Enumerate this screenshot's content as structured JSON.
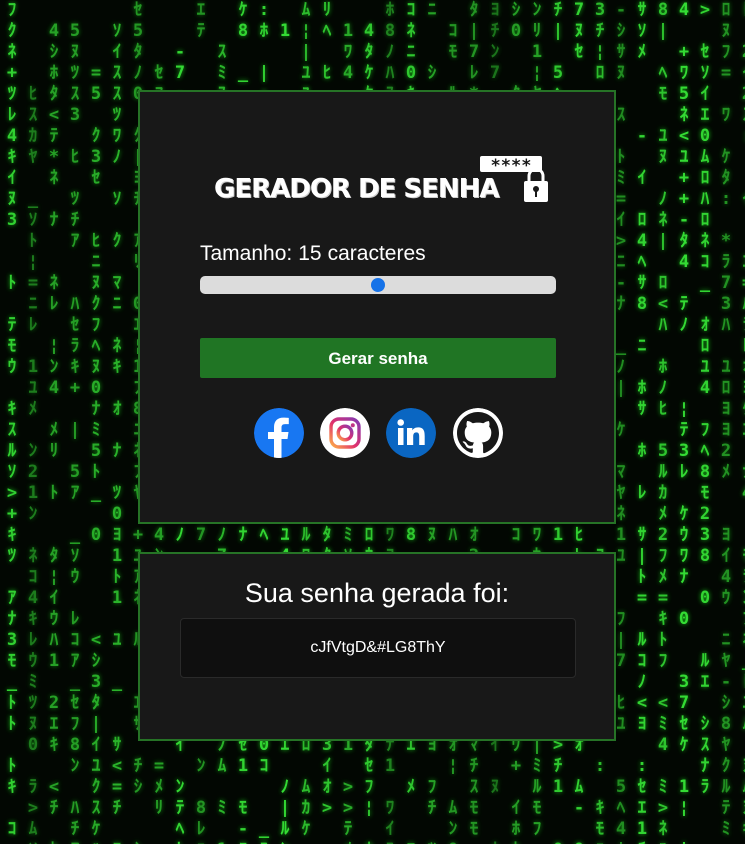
{
  "logo": {
    "text": "GERADOR DE SENHA",
    "stars": "****"
  },
  "size": {
    "prefix": "Tamanho:",
    "value": 15,
    "suffix": "caracteres",
    "fraction": 0.5
  },
  "generate_button": {
    "label": "Gerar senha",
    "color": "#207524"
  },
  "social": [
    {
      "name": "facebook-icon"
    },
    {
      "name": "instagram-icon"
    },
    {
      "name": "linkedin-icon"
    },
    {
      "name": "github-icon"
    }
  ],
  "result": {
    "title": "Sua senha gerada foi:",
    "password": "cJfVtgD&#LG8ThY"
  },
  "colors": {
    "accent": "#207524",
    "card": "#181818",
    "slider_thumb": "#1572e8",
    "matrix": "#35e035"
  }
}
